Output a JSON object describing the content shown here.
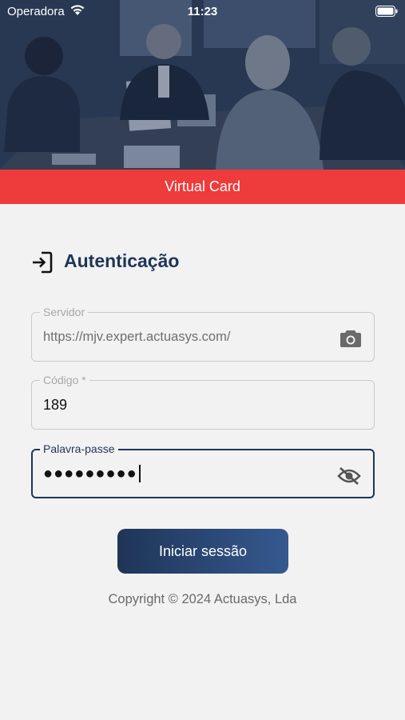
{
  "status_bar": {
    "carrier": "Operadora",
    "time": "11:23"
  },
  "hero": {
    "image": "business-meeting-photo"
  },
  "banner": {
    "title": "Virtual Card"
  },
  "auth": {
    "icon": "login-icon",
    "title": "Autenticação"
  },
  "fields": {
    "server": {
      "label": "Servidor",
      "value": "https://mjv.expert.actuasys.com/",
      "icon": "camera-icon"
    },
    "code": {
      "label": "Código *",
      "value": "189"
    },
    "password": {
      "label": "Palavra-passe",
      "value": "●●●●●●●●●",
      "icon": "eye-off-icon"
    }
  },
  "actions": {
    "submit_label": "Iniciar sessão"
  },
  "footer": {
    "copyright": "Copyright © 2024 Actuasys, Lda"
  },
  "colors": {
    "primary": "#1f3557",
    "banner": "#ee3b3b",
    "background": "#f2f2f2"
  }
}
